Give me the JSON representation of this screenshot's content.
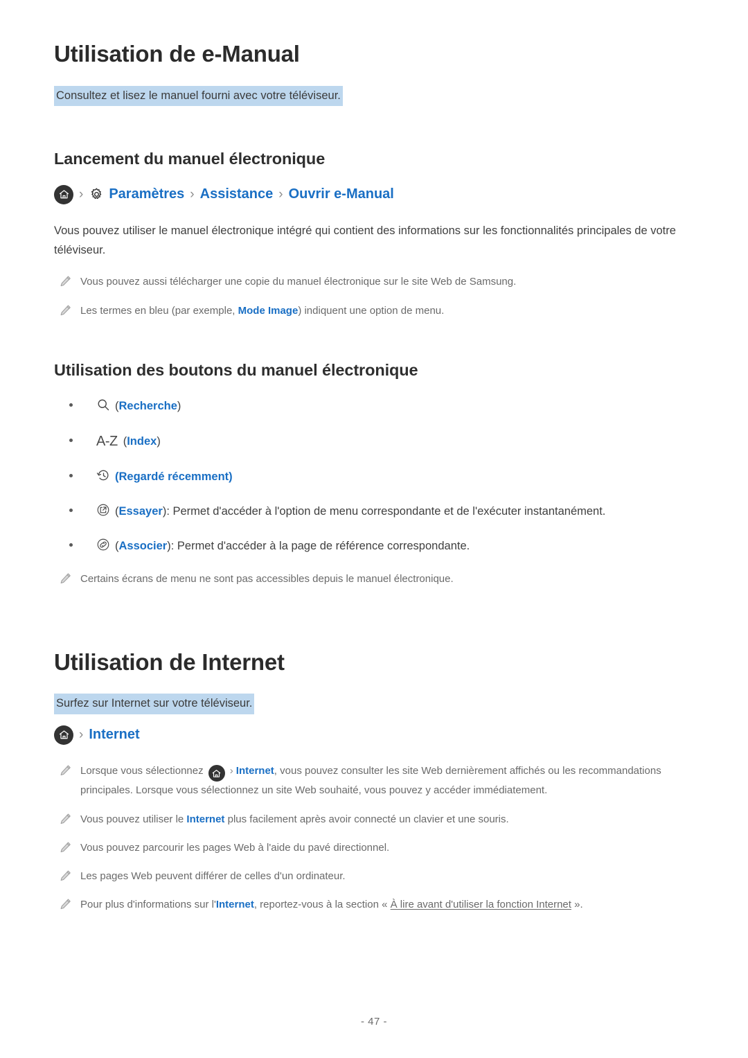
{
  "page": {
    "footer": "- 47 -"
  },
  "sections": [
    {
      "title": "Utilisation de e-Manual",
      "subtitle_highlight": "Consultez et lisez le manuel fourni avec votre téléviseur.",
      "sub_heading_1": "Lancement du manuel électronique",
      "breadcrumb": {
        "home_icon": "home-icon",
        "gear_icon": "gear-icon",
        "separator": "›",
        "items": [
          "Paramètres",
          "Assistance",
          "Ouvrir e-Manual"
        ]
      },
      "paragraph": "Vous pouvez utiliser le manuel électronique intégré qui contient des informations sur les fonctionnalités principales de votre téléviseur.",
      "notes_1": [
        {
          "icon": "pencil-icon",
          "text": "Vous pouvez aussi télécharger une copie du manuel électronique sur le site Web de Samsung."
        },
        {
          "icon": "pencil-icon",
          "prefix": "Les termes en bleu (par exemple, ",
          "link": "Mode Image",
          "suffix": ") indiquent une option de menu."
        }
      ],
      "sub_heading_2": "Utilisation des boutons du manuel électronique",
      "buttons": [
        {
          "icon": "search-icon",
          "open_paren": "(",
          "label": "Recherche",
          "close_paren": ")",
          "description": ""
        },
        {
          "icon": "a-z-icon",
          "icon_text": "A-Z",
          "open_paren": "(",
          "label": "Index",
          "close_paren": ")",
          "description": ""
        },
        {
          "icon": "recent-history-icon",
          "open_paren": "(",
          "label": "Regardé récemment",
          "close_paren": ")",
          "description": ""
        },
        {
          "icon": "try-it-icon",
          "open_paren": "(",
          "label": "Essayer",
          "close_paren": ")",
          "description": ": Permet d'accéder à l'option de menu correspondante et de l'exécuter instantanément."
        },
        {
          "icon": "link-icon",
          "open_paren": "(",
          "label": "Associer",
          "close_paren": ")",
          "description": ": Permet d'accéder à la page de référence correspondante."
        }
      ],
      "notes_2": [
        {
          "icon": "pencil-icon",
          "text": "Certains écrans de menu ne sont pas accessibles depuis le manuel électronique."
        }
      ]
    },
    {
      "title": "Utilisation de Internet",
      "subtitle_highlight": "Surfez sur Internet sur votre téléviseur.",
      "breadcrumb": {
        "home_icon": "home-icon",
        "separator": "›",
        "items": [
          "Internet"
        ]
      },
      "notes": [
        {
          "icon": "pencil-icon",
          "prefix": "Lorsque vous sélectionnez ",
          "inline_icon": "home-icon",
          "separator": "›",
          "link": "Internet",
          "suffix": ", vous pouvez consulter les site Web dernièrement affichés ou les recommandations principales. Lorsque vous sélectionnez un site Web souhaité, vous pouvez y accéder immédiatement."
        },
        {
          "icon": "pencil-icon",
          "prefix": "Vous pouvez utiliser le ",
          "link": "Internet",
          "suffix": " plus facilement après avoir connecté un clavier et une souris."
        },
        {
          "icon": "pencil-icon",
          "text": "Vous pouvez parcourir les pages Web à l'aide du pavé directionnel."
        },
        {
          "icon": "pencil-icon",
          "text": "Les pages Web peuvent différer de celles d'un ordinateur."
        },
        {
          "icon": "pencil-icon",
          "prefix": "Pour plus d'informations sur l'",
          "link": "Internet",
          "mid": ", reportez-vous à la section « ",
          "ref_link": "À lire avant d'utiliser la fonction Internet",
          "suffix": " »."
        }
      ]
    }
  ],
  "colors": {
    "link_blue": "#1a6fc4",
    "highlight": "#bdd7ee",
    "body_text": "#3f3f3f",
    "note_text": "#6a6a6a",
    "heading": "#2b2b2b",
    "icon_dark": "#333333"
  }
}
